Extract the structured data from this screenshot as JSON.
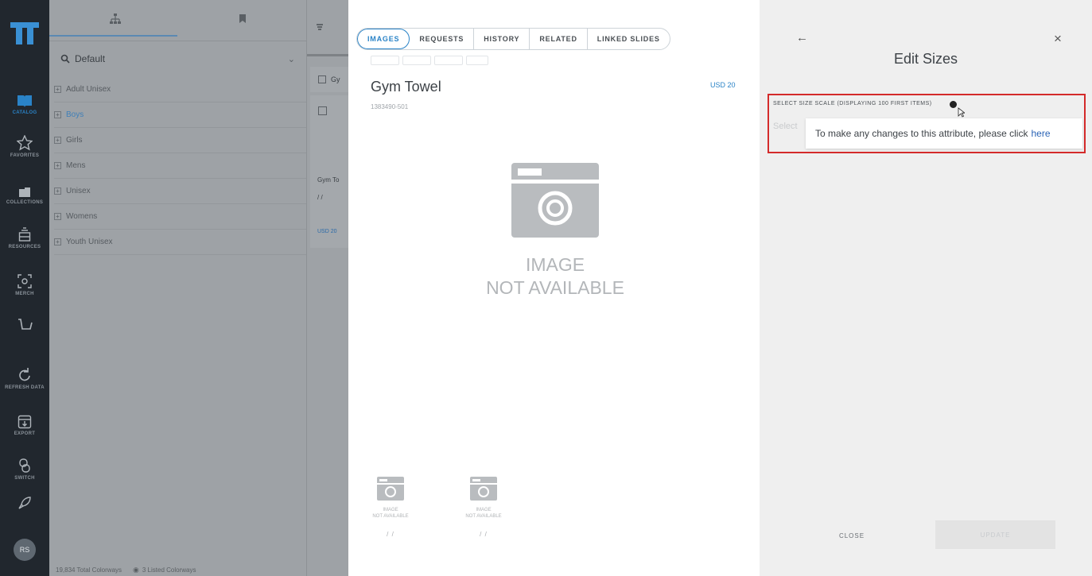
{
  "sidebar": {
    "items": [
      {
        "label": "CATALOG",
        "icon": "book-icon"
      },
      {
        "label": "FAVORITES",
        "icon": "star-icon"
      },
      {
        "label": "COLLECTIONS",
        "icon": "folder-icon"
      },
      {
        "label": "RESOURCES",
        "icon": "stack-icon"
      },
      {
        "label": "MERCH",
        "icon": "merch-icon"
      },
      {
        "label": "",
        "icon": "cart-icon"
      },
      {
        "label": "REFRESH DATA",
        "icon": "refresh-icon"
      },
      {
        "label": "EXPORT",
        "icon": "export-icon"
      },
      {
        "label": "SWITCH",
        "icon": "switch-icon"
      },
      {
        "label": "",
        "icon": "rocket-icon"
      }
    ],
    "avatar": "RS",
    "accent": "#2a83c7"
  },
  "tree": {
    "search_value": "Default",
    "items": [
      "Adult Unisex",
      "Boys",
      "Girls",
      "Mens",
      "Unisex",
      "Womens",
      "Youth Unisex"
    ]
  },
  "mid": {
    "row_label": "Gy",
    "product_short": "Gym To",
    "slashes": "/ /",
    "price": "USD 20"
  },
  "footer": {
    "total": "19,834 Total Colorways",
    "listed": "3 Listed Colorways"
  },
  "detail": {
    "tabs": [
      "IMAGES",
      "REQUESTS",
      "HISTORY",
      "RELATED",
      "LINKED SLIDES"
    ],
    "product_name": "Gym Towel",
    "sku": "1383490-501",
    "price": "USD 20",
    "placeholder_line1": "IMAGE",
    "placeholder_line2": "NOT AVAILABLE",
    "thumbs": [
      {
        "line1": "IMAGE",
        "line2": "NOT AVAILABLE",
        "caption": "/ /"
      },
      {
        "line1": "IMAGE",
        "line2": "NOT AVAILABLE",
        "caption": "/ /"
      }
    ]
  },
  "edit": {
    "title": "Edit Sizes",
    "scale_label": "SELECT SIZE SCALE (DISPLAYING 100 FIRST ITEMS)",
    "select_placeholder": "Select",
    "tooltip_text": "To make any changes to this attribute, please click",
    "tooltip_link": "here",
    "close_label": "CLOSE",
    "update_label": "UPDATE",
    "highlight_color": "#d42a2a"
  }
}
